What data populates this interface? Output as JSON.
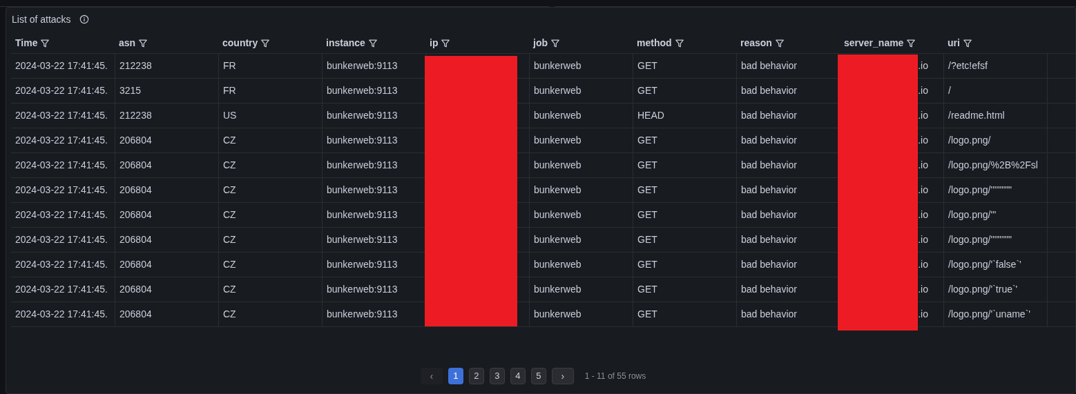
{
  "panel": {
    "title": "List of attacks"
  },
  "table": {
    "columns": [
      "Time",
      "asn",
      "country",
      "instance",
      "ip",
      "job",
      "method",
      "reason",
      "server_name",
      "uri"
    ],
    "rows": [
      [
        "2024-03-22 17:41:45.",
        "212238",
        "FR",
        "bunkerweb:9113",
        "",
        "bunkerweb",
        "GET",
        "bad behavior",
        ".io",
        "/?etc!efsf"
      ],
      [
        "2024-03-22 17:41:45.",
        "3215",
        "FR",
        "bunkerweb:9113",
        "",
        "bunkerweb",
        "GET",
        "bad behavior",
        ".io",
        "/"
      ],
      [
        "2024-03-22 17:41:45.",
        "212238",
        "US",
        "bunkerweb:9113",
        "",
        "bunkerweb",
        "HEAD",
        "bad behavior",
        ".io",
        "/readme.html"
      ],
      [
        "2024-03-22 17:41:45.",
        "206804",
        "CZ",
        "bunkerweb:9113",
        "",
        "bunkerweb",
        "GET",
        "bad behavior",
        ".io",
        "/logo.png/"
      ],
      [
        "2024-03-22 17:41:45.",
        "206804",
        "CZ",
        "bunkerweb:9113",
        "",
        "bunkerweb",
        "GET",
        "bad behavior",
        ".io",
        "/logo.png/%2B%2Fsl"
      ],
      [
        "2024-03-22 17:41:45.",
        "206804",
        "CZ",
        "bunkerweb:9113",
        "",
        "bunkerweb",
        "GET",
        "bad behavior",
        ".io",
        "/logo.png/''''\"\"\"\""
      ],
      [
        "2024-03-22 17:41:45.",
        "206804",
        "CZ",
        "bunkerweb:9113",
        "",
        "bunkerweb",
        "GET",
        "bad behavior",
        ".io",
        "/logo.png/'\""
      ],
      [
        "2024-03-22 17:41:45.",
        "206804",
        "CZ",
        "bunkerweb:9113",
        "",
        "bunkerweb",
        "GET",
        "bad behavior",
        ".io",
        "/logo.png/'\"'\"'\"'\""
      ],
      [
        "2024-03-22 17:41:45.",
        "206804",
        "CZ",
        "bunkerweb:9113",
        "",
        "bunkerweb",
        "GET",
        "bad behavior",
        ".io",
        "/logo.png/'`false`'"
      ],
      [
        "2024-03-22 17:41:45.",
        "206804",
        "CZ",
        "bunkerweb:9113",
        "",
        "bunkerweb",
        "GET",
        "bad behavior",
        ".io",
        "/logo.png/'`true`'"
      ],
      [
        "2024-03-22 17:41:45.",
        "206804",
        "CZ",
        "bunkerweb:9113",
        "",
        "bunkerweb",
        "GET",
        "bad behavior",
        ".io",
        "/logo.png/'`uname`'"
      ]
    ]
  },
  "pagination": {
    "prev": "‹",
    "next": "›",
    "pages": [
      {
        "label": "1",
        "selected": true
      },
      {
        "label": "2",
        "selected": false
      },
      {
        "label": "3",
        "selected": false
      },
      {
        "label": "4",
        "selected": false
      },
      {
        "label": "5",
        "selected": false
      }
    ],
    "summary": "1 - 11 of 55 rows"
  }
}
